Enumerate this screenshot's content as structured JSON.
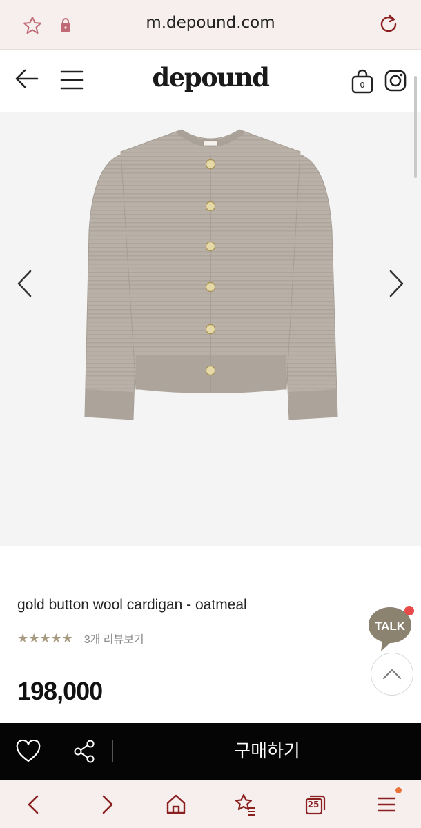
{
  "browser": {
    "url": "m.depound.com",
    "tab_count": "25"
  },
  "header": {
    "logo": "depound",
    "cart_count": "0"
  },
  "product": {
    "name": "gold button wool cardigan - oatmeal",
    "stars": "★★★★★",
    "review_link": "3개 리뷰보기",
    "price": "198,000",
    "image_color": "#b7afa5"
  },
  "floating": {
    "talk_label": "TALK"
  },
  "buybar": {
    "buy_label": "구매하기"
  },
  "colors": {
    "browser_chrome": "#f6efee",
    "browser_icon": "#8b2020",
    "buybar_bg": "#050505",
    "star_color": "#a89a80",
    "talk_bubble": "#8c8270"
  }
}
